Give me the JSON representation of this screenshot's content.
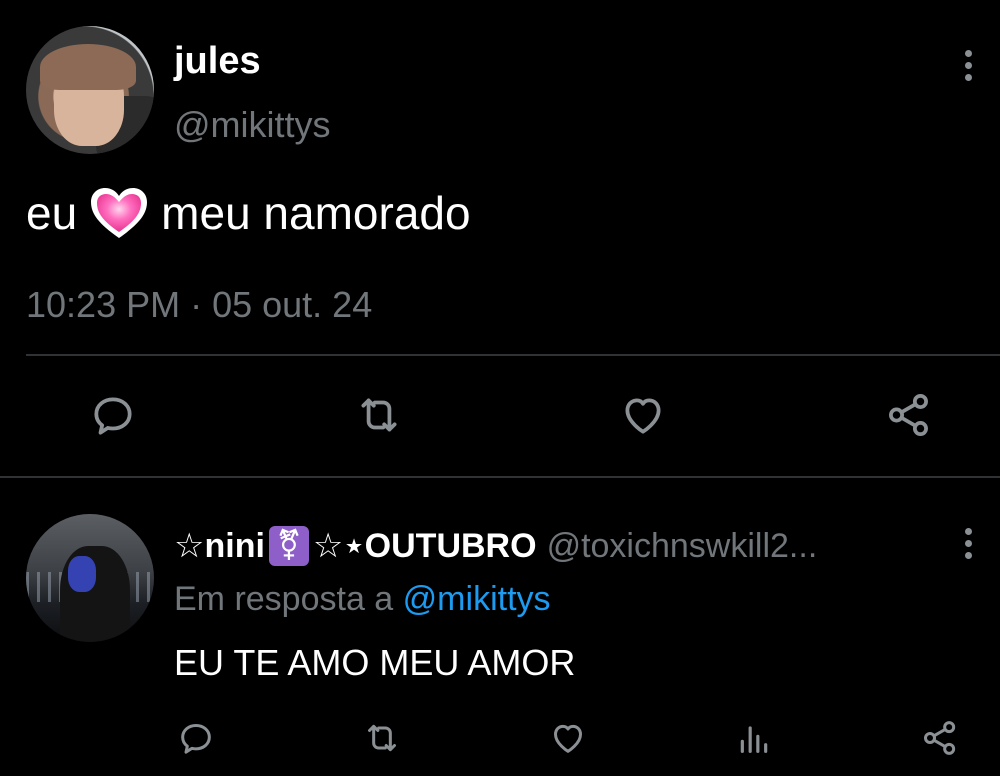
{
  "main_tweet": {
    "author_name": "jules",
    "author_handle": "@mikittys",
    "text_before": "eu",
    "text_after": "meu namorado",
    "emoji": "pink-heart-emoji",
    "timestamp": "10:23 PM · 05 out. 24",
    "actions": [
      "reply-icon",
      "retweet-icon",
      "like-icon",
      "share-icon"
    ]
  },
  "reply": {
    "author_name_prefix": "☆nini",
    "author_name_symbol": "⚧",
    "author_name_suffix": "☆⋆OUTUBRO",
    "author_handle": "@toxichnswkill2...",
    "reply_to_label": "Em resposta a",
    "reply_to_handle": "@mikittys",
    "text": "EU TE AMO MEU AMOR",
    "actions": [
      "reply-icon",
      "retweet-icon",
      "like-icon",
      "views-icon",
      "share-icon"
    ]
  },
  "colors": {
    "background": "#000000",
    "text_primary": "#ffffff",
    "text_secondary": "#71767b",
    "accent": "#1d9bf0",
    "divider": "#2f3336",
    "trans_symbol_bg": "#8e5fc8"
  }
}
